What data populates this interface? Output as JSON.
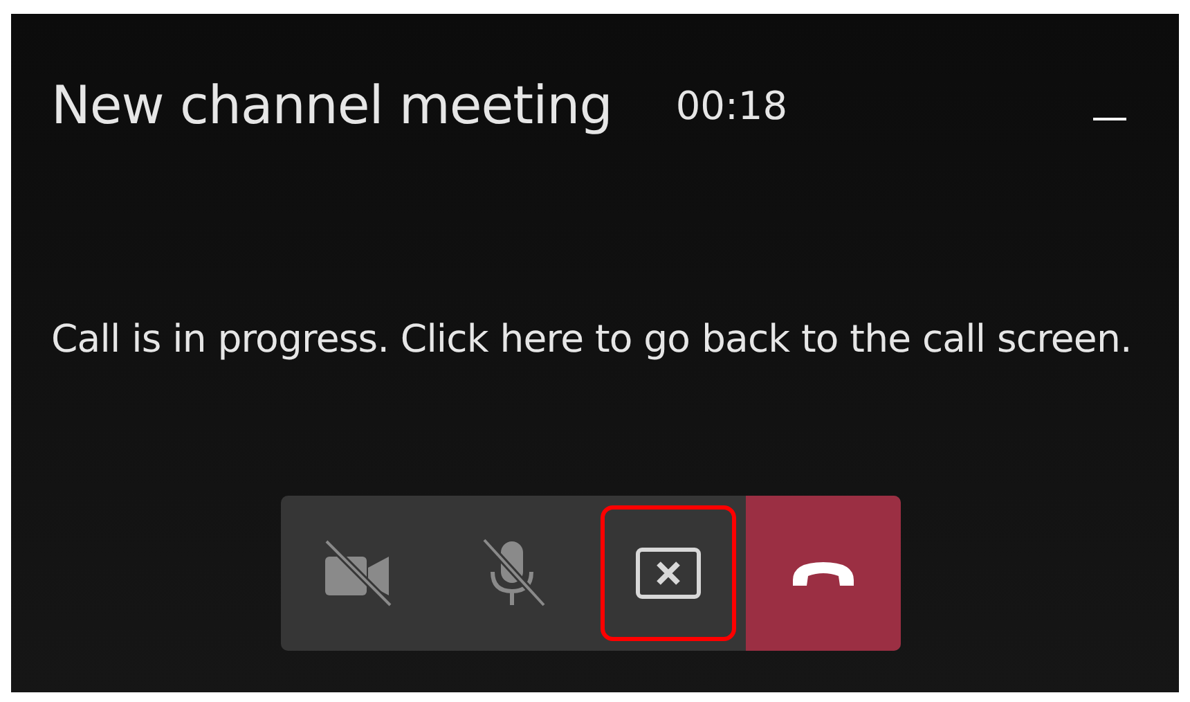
{
  "header": {
    "title": "New channel meeting",
    "timer": "00:18"
  },
  "message": "Call is in progress. Click here to go back to the call screen.",
  "controls": [
    {
      "kind": "camera",
      "disabled": true,
      "highlighted": false
    },
    {
      "kind": "mic",
      "disabled": true,
      "highlighted": false
    },
    {
      "kind": "stop-share",
      "disabled": false,
      "highlighted": true
    },
    {
      "kind": "hangup",
      "disabled": false,
      "highlighted": false
    }
  ]
}
